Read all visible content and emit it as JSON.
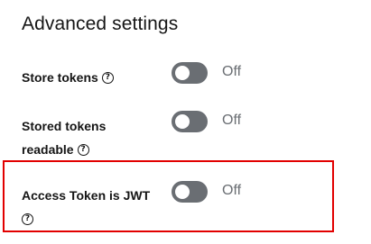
{
  "section": {
    "title": "Advanced settings"
  },
  "settings": [
    {
      "label": "Store tokens",
      "state": "Off",
      "enabled": false
    },
    {
      "label_line1": "Stored tokens",
      "label_line2": "readable",
      "state": "Off",
      "enabled": false
    },
    {
      "label": "Access Token is JWT",
      "state": "Off",
      "enabled": false,
      "highlighted": true
    }
  ],
  "help_glyph": "?",
  "colors": {
    "highlight": "#e20000",
    "toggle_off": "#6a6e73",
    "text": "#151515"
  }
}
